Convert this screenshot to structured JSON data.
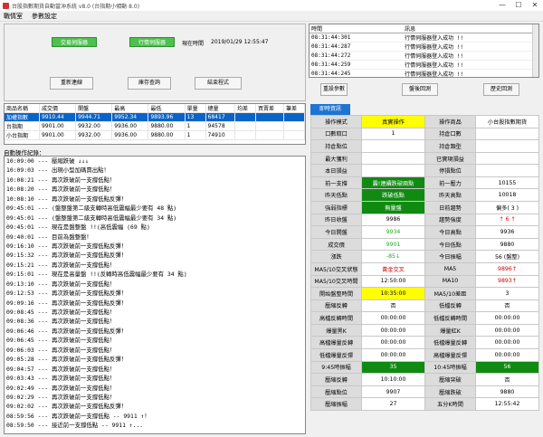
{
  "title": "台股指數期貨自動當沖系統 v8.0 (台指期小傾動 8.0)",
  "window_buttons": {
    "minimize": "—",
    "maximize": "☐",
    "close": "✕"
  },
  "menu": [
    "戰情室",
    "參數設定"
  ],
  "control": {
    "btn_trade_server": "交易伺服器",
    "btn_quote_server": "行情伺服器",
    "time_label": "現在時間",
    "time_value": "2019/01/29 12:55:47",
    "btn_reconnect": "重新連線",
    "btn_inventory": "庫存查詢",
    "btn_exit": "結束程式"
  },
  "messages": {
    "col_time": "時間",
    "col_msg": "訊息",
    "rows": [
      {
        "time": "08:31:44:301",
        "msg": "行情伺服器登入成功 !!"
      },
      {
        "time": "08:31:44:287",
        "msg": "行情伺服器登入成功 !!"
      },
      {
        "time": "08:31:44:272",
        "msg": "行情伺服器登入成功 !!"
      },
      {
        "time": "08:31:44:259",
        "msg": "行情伺服器登入成功 !!"
      },
      {
        "time": "08:31:44:245",
        "msg": "行情伺服器登入成功 !!"
      }
    ]
  },
  "right_buttons": {
    "reset": "重設參數",
    "order_back": "盤後回測",
    "history": "歷史回測"
  },
  "stock_grid": {
    "headers": [
      "商品名稱",
      "成交價",
      "開盤",
      "最高",
      "最低",
      "單量",
      "總量",
      "均差",
      "買賣差",
      "筆差"
    ],
    "rows": [
      [
        "加權指數",
        "9910.44",
        "9944.71",
        "9952.34",
        "9893.96",
        "13",
        "68417",
        "",
        "",
        ""
      ],
      [
        "台指期",
        "9901.00",
        "9932.00",
        "9936.00",
        "9880.00",
        "1",
        "94578",
        "",
        "",
        ""
      ],
      [
        "小台指期",
        "9901.00",
        "9932.00",
        "9936.00",
        "9880.00",
        "1",
        "74910",
        "",
        "",
        ""
      ]
    ]
  },
  "log_label": "自動操作紀錄：",
  "log_lines": [
    "10:09:00 --- 壓縮跌破 ↓↓↓",
    "10:09:03 --- 出現小型加碼賣出點！",
    "10:08:21 --- 再次跌破前一支撐低點！",
    "10:08:20 --- 再次跌破前一支撐低點！",
    "10:08:10 --- 再次跌破前一支撐低點反彈！",
    "09:45:01 --- (盤整盤第二級支轉時高低震幅最少要有 48 點)",
    "09:45:01 --- (盤整盤第二級支轉時高低震幅最少要有 34 點)",
    "09:45:01 --- 現在是盤整盤 !!(高低震幅 (69 點)",
    "09:40:01 --- 目前為盤整盤！",
    "09:16:10 --- 再次跌破前一支撐低點反彈！",
    "09:15:32 --- 再次跌破前一支撐低點反彈！",
    "09:15:21 --- 再次跌破前一支撐低點！",
    "09:15:01 --- 現在是高量盤 !!(反轉時高低震幅最少要有 34 點)",
    "09:13:10 --- 再次跌破前一支撐低點！",
    "09:12:53 --- 再次跌破前一支撐低點反彈！",
    "09:09:16 --- 再次跌破前一支撐低點反彈！",
    "09:08:45 --- 再次跌破前一支撐低點！",
    "09:08:36 --- 再次跌破前一支撐低點！",
    "09:06:46 --- 再次跌破前一支撐低點反彈！",
    "09:06:45 --- 再次跌破前一支撐低點！",
    "09:06:03 --- 再次跌破前一支撐低點！",
    "09:05:28 --- 再次跌破前一支撐低點反彈！",
    "09:04:57 --- 再次跌破前一支撐低點！",
    "09:03:43 --- 再次跌破前一支撐低點！",
    "09:02:49 --- 再次跌破前一支撐低點！",
    "09:02:29 --- 再次跌破前一支撐低點！",
    "09:02:02 --- 再次跌破前一支撐低點反彈！",
    "08:59:56 --- 再次跌破前一支撐低點 -- 9911 ↑！",
    "08:59:50 --- 接近前一支撐低點 -- 9911 ↑..."
  ],
  "right_tab": "即時資訊",
  "info": [
    [
      {
        "t": "操作模式"
      },
      {
        "t": "真實操作",
        "c": "yellow"
      },
      {
        "t": "操作商品"
      },
      {
        "t": "小台股指數期貨"
      }
    ],
    [
      {
        "t": "口數取口"
      },
      {
        "t": "1"
      },
      {
        "t": "持倉口數"
      },
      {
        "t": ""
      }
    ],
    [
      {
        "t": "持倉點位"
      },
      {
        "t": ""
      },
      {
        "t": "持倉類型"
      },
      {
        "t": ""
      }
    ],
    [
      {
        "t": "最大獲利"
      },
      {
        "t": ""
      },
      {
        "t": "已實現損益"
      },
      {
        "t": ""
      }
    ],
    [
      {
        "t": "本日損益"
      },
      {
        "t": ""
      },
      {
        "t": "停損點位"
      },
      {
        "t": ""
      }
    ],
    [
      {
        "t": "前一支撐"
      },
      {
        "t": "震!連續跌破兩點",
        "c": "darkgreen"
      },
      {
        "t": "前一壓力"
      },
      {
        "t": "10155"
      }
    ],
    [
      {
        "t": "昨天低點"
      },
      {
        "t": "跌破低點",
        "c": "darkgreen"
      },
      {
        "t": "昨天高點"
      },
      {
        "t": "10018"
      }
    ],
    [
      {
        "t": "強弱指標"
      },
      {
        "t": "無量盤",
        "c": "darkgreen"
      },
      {
        "t": "日前趨勢"
      },
      {
        "t": "偏多( 3 )"
      }
    ],
    [
      {
        "t": "昨日收盤"
      },
      {
        "t": "9986"
      },
      {
        "t": "趨勢強度"
      },
      {
        "t": "↑ 6 ↑",
        "c": "red"
      }
    ],
    [
      {
        "t": "今日開盤"
      },
      {
        "t": "9934",
        "c": "green"
      },
      {
        "t": "今日高點"
      },
      {
        "t": "9936"
      }
    ],
    [
      {
        "t": "成交價"
      },
      {
        "t": "9901",
        "c": "green"
      },
      {
        "t": "今日低點"
      },
      {
        "t": "9880"
      }
    ],
    [
      {
        "t": "漲跌"
      },
      {
        "t": "-85↓",
        "c": "green"
      },
      {
        "t": "今日振幅"
      },
      {
        "t": "56 (盤整)"
      }
    ],
    [
      {
        "t": "MA5/10交叉狀態"
      },
      {
        "t": "黃金交叉",
        "c": "darkred"
      },
      {
        "t": "MA5"
      },
      {
        "t": "9896↑",
        "c": "darkred"
      }
    ],
    [
      {
        "t": "MA5/10交叉時間"
      },
      {
        "t": "12:50:00"
      },
      {
        "t": "MA10"
      },
      {
        "t": "9893↑",
        "c": "darkred"
      }
    ],
    [
      {
        "t": "開始盤整時間"
      },
      {
        "t": "10:35:00",
        "c": "yellow"
      },
      {
        "t": "MA5/10差距"
      },
      {
        "t": "3"
      }
    ],
    [
      {
        "t": "壓縮反轉"
      },
      {
        "t": "否"
      },
      {
        "t": "低檔反轉"
      },
      {
        "t": "否"
      }
    ],
    [
      {
        "t": "高檔反轉時間"
      },
      {
        "t": "00:00:00"
      },
      {
        "t": "低檔反轉時間"
      },
      {
        "t": "00:00:00"
      }
    ],
    [
      {
        "t": "爆量黑K"
      },
      {
        "t": "00:00:00"
      },
      {
        "t": "爆量紅K"
      },
      {
        "t": "00:00:00"
      }
    ],
    [
      {
        "t": "高檔爆量反轉"
      },
      {
        "t": "00:00:00"
      },
      {
        "t": "低檔爆量反轉"
      },
      {
        "t": "00:00:00"
      }
    ],
    [
      {
        "t": "低檔爆量反彈"
      },
      {
        "t": "00:00:00"
      },
      {
        "t": "高檔爆量反彈"
      },
      {
        "t": "00:00:00"
      }
    ],
    [
      {
        "t": "9:45時振幅"
      },
      {
        "t": "35",
        "c": "darkgreen"
      },
      {
        "t": "10:45時振幅"
      },
      {
        "t": "56",
        "c": "darkgreen"
      }
    ],
    [
      {
        "t": "壓縮反轉"
      },
      {
        "t": "10:10:00"
      },
      {
        "t": "壓縮突破"
      },
      {
        "t": "否"
      }
    ],
    [
      {
        "t": "壓縮點位"
      },
      {
        "t": "9907"
      },
      {
        "t": "壓縮跌破"
      },
      {
        "t": "9880"
      }
    ],
    [
      {
        "t": "壓縮振幅"
      },
      {
        "t": "27"
      },
      {
        "t": "五分K時間"
      },
      {
        "t": "12:55:42"
      }
    ]
  ]
}
